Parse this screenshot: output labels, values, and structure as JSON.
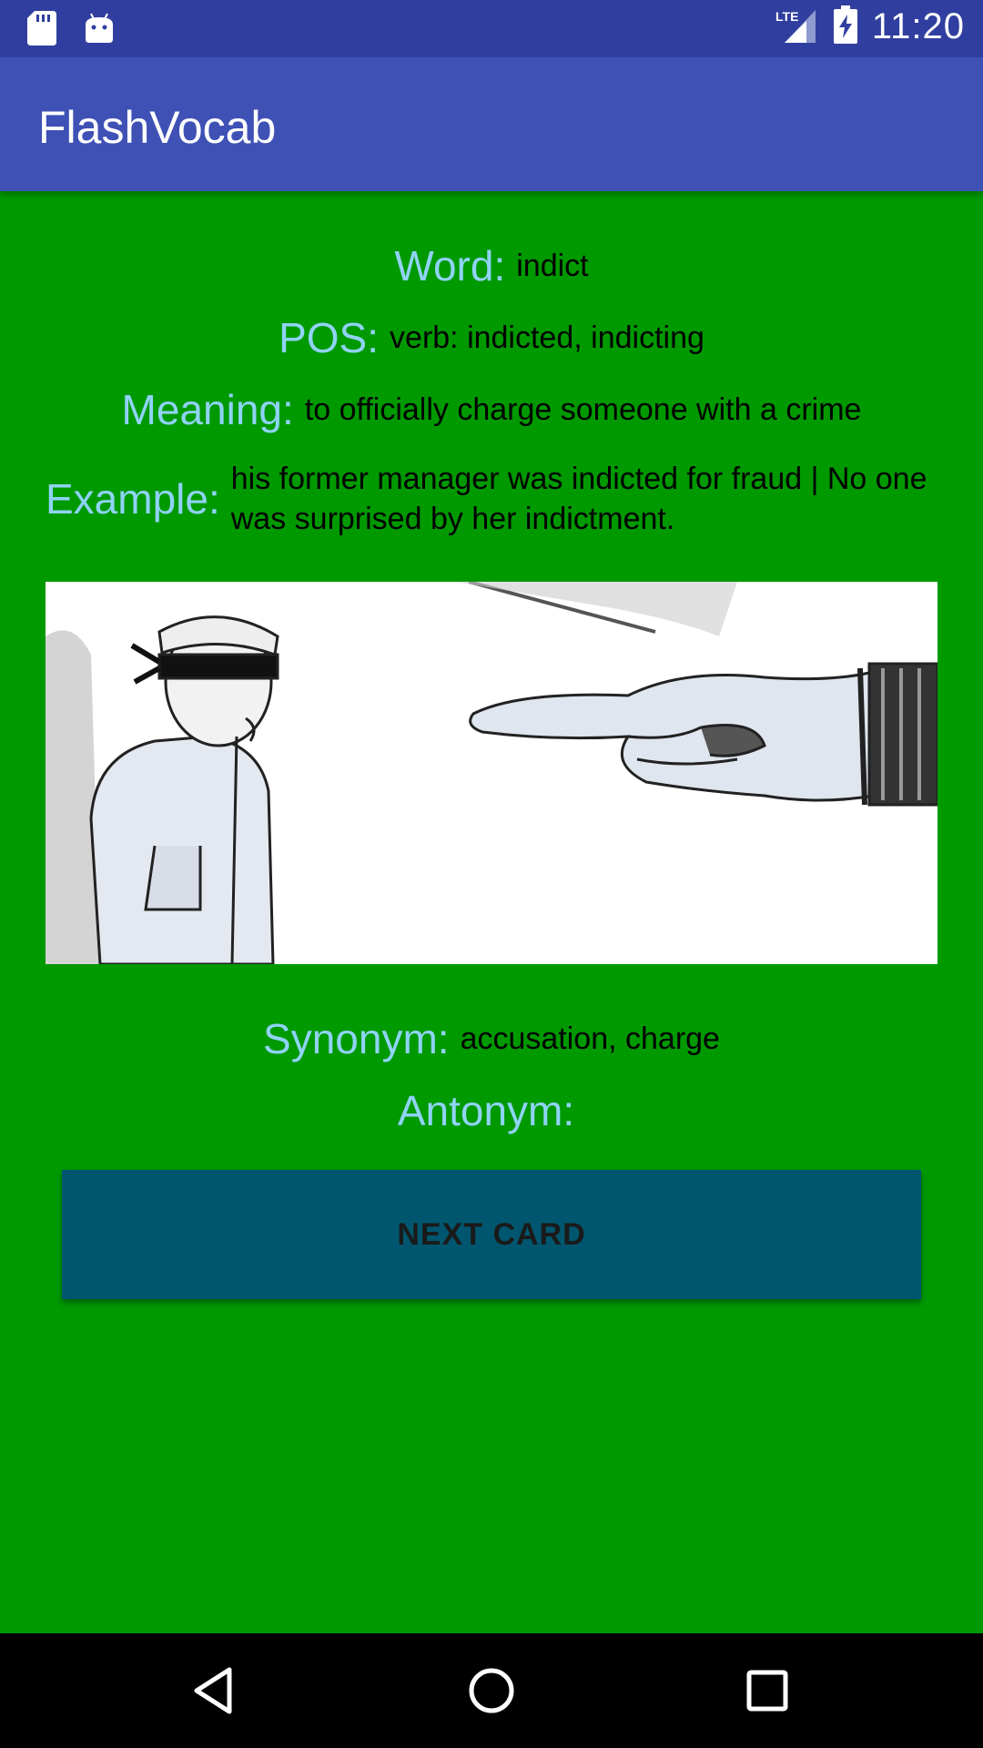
{
  "status_bar": {
    "time": "11:20",
    "network": "LTE",
    "icons": [
      "sd-card-icon",
      "android-icon",
      "lte-signal-icon",
      "battery-charging-icon"
    ]
  },
  "app_bar": {
    "title": "FlashVocab",
    "color": "#3f51b5"
  },
  "card": {
    "background": "#009900",
    "word_label": "Word:",
    "word": "indict",
    "pos_label": "POS:",
    "pos": "verb: indicted, indicting",
    "meaning_label": "Meaning:",
    "meaning": "to officially charge someone with a crime",
    "example_label": "Example:",
    "example": "his former manager was indicted for fraud | No one was surprised by her indictment.",
    "image_icon": "accusation-illustration",
    "synonym_label": "Synonym:",
    "synonym": "accusation, charge",
    "antonym_label": "Antonym:",
    "antonym": ""
  },
  "next_button": {
    "label": "NEXT CARD",
    "color": "#00566e"
  },
  "nav_bar": {
    "icons": [
      "back-icon",
      "home-icon",
      "recents-icon"
    ]
  }
}
